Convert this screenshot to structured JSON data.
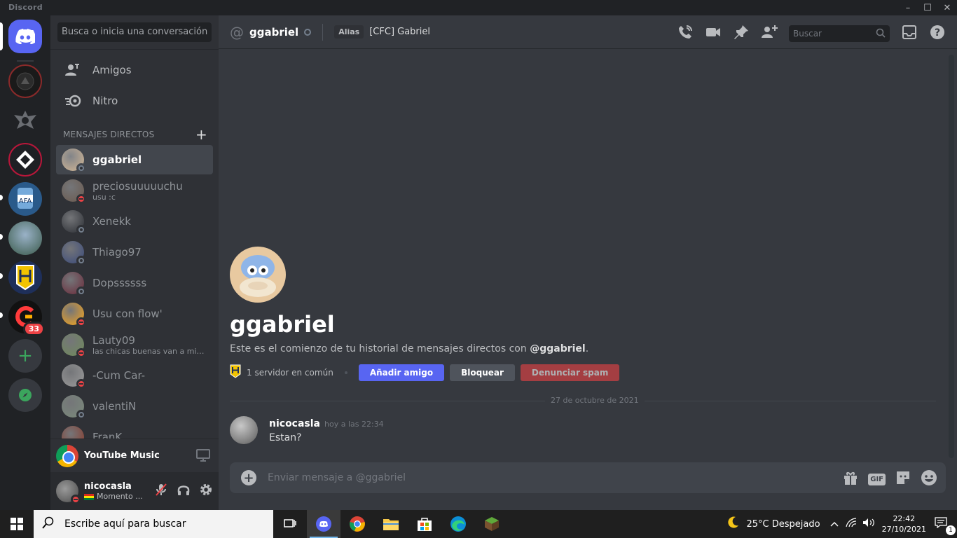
{
  "window": {
    "brand": "Discord"
  },
  "guilds": {
    "unread_badge": "33"
  },
  "sidebar": {
    "search_placeholder": "Busca o inicia una conversación",
    "nav": [
      {
        "label": "Amigos",
        "icon": "friends-icon"
      },
      {
        "label": "Nitro",
        "icon": "nitro-icon"
      }
    ],
    "dm_header": "MENSAJES DIRECTOS",
    "dms": [
      {
        "name": "ggabriel",
        "sub": "",
        "status": "offline",
        "active": true,
        "avatar_color": "#d4b896"
      },
      {
        "name": "preciosuuuuuchu",
        "sub": "usu :c",
        "status": "dnd",
        "active": false,
        "avatar_color": "#6b5a4e"
      },
      {
        "name": "Xenekk",
        "sub": "",
        "status": "offline",
        "active": false,
        "avatar_color": "#2a2d33"
      },
      {
        "name": "Thiago97",
        "sub": "",
        "status": "offline",
        "active": false,
        "avatar_color": "#3a4a7a"
      },
      {
        "name": "Dopssssss",
        "sub": "",
        "status": "offline",
        "active": false,
        "avatar_color": "#6a2a3a"
      },
      {
        "name": "Usu con flow'",
        "sub": "",
        "status": "dnd",
        "active": false,
        "avatar_color": "#faa61a"
      },
      {
        "name": "Lauty09",
        "sub": "las chicas buenas van a misa,...",
        "status": "dnd",
        "active": false,
        "avatar_color": "#6f8a5a"
      },
      {
        "name": "-Cum Car-",
        "sub": "",
        "status": "dnd",
        "active": false,
        "avatar_color": "#9a9a9a"
      },
      {
        "name": "valentiN",
        "sub": "",
        "status": "offline",
        "active": false,
        "avatar_color": "#7a8a7a"
      },
      {
        "name": "FranK",
        "sub": "",
        "status": "offline",
        "active": false,
        "avatar_color": "#8a3a2a"
      }
    ],
    "now_playing": "YouTube Music",
    "user": {
      "name": "nicocasla",
      "status_text": "Momento ..."
    }
  },
  "header": {
    "title": "ggabriel",
    "alias_label": "Alias",
    "alias": "[CFC] Gabriel",
    "search_placeholder": "Buscar"
  },
  "welcome": {
    "name": "ggabriel",
    "desc_prefix": "Este es el comienzo de tu historial de mensajes directos con ",
    "desc_mention": "@ggabriel",
    "desc_suffix": ".",
    "mutual": "1 servidor en común",
    "add_friend": "Añadir amigo",
    "block": "Bloquear",
    "report_spam": "Denunciar spam"
  },
  "date_divider": "27 de octubre de 2021",
  "messages": [
    {
      "author": "nicocasla",
      "time": "hoy a las 22:34",
      "text": "Estan?"
    }
  ],
  "composer": {
    "placeholder": "Enviar mensaje a @ggabriel",
    "gif": "GIF"
  },
  "taskbar": {
    "search_placeholder": "Escribe aquí para buscar",
    "weather": "25°C  Despejado",
    "time": "22:42",
    "date": "27/10/2021",
    "notifications": "1"
  },
  "colors": {
    "blurple": "#5865f2",
    "dnd": "#ed4245",
    "offline": "#747f8d"
  }
}
